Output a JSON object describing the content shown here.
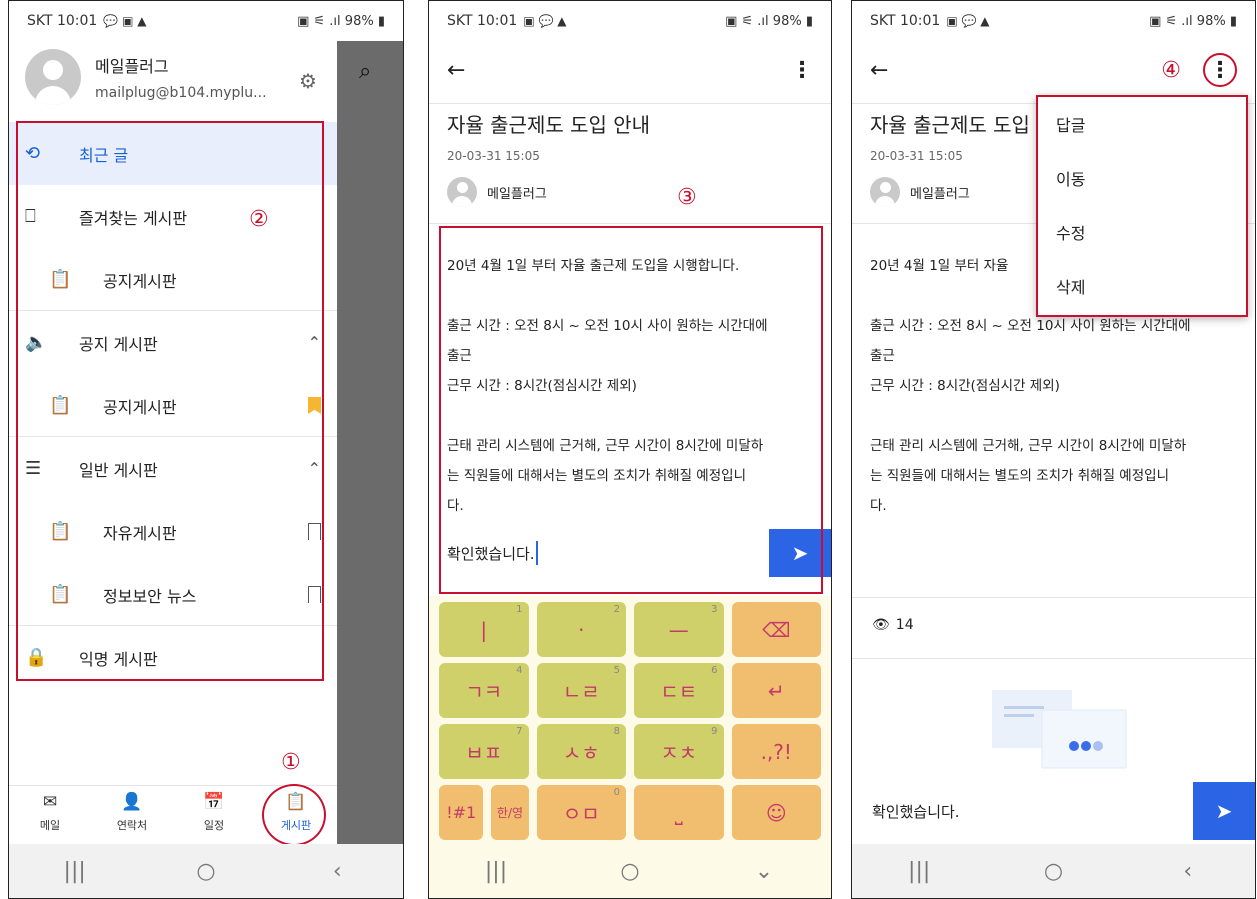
{
  "status": {
    "carrier_time": "SKT 10:01",
    "battery": "98%",
    "signal": "█ ≈ ≡ .▎"
  },
  "callouts": {
    "one": "①",
    "two": "②",
    "three": "③",
    "four": "④"
  },
  "drawer": {
    "profile": {
      "name": "메일플러그",
      "email": "mailplug@b104.myplu..."
    },
    "items": [
      {
        "label": "최근 글",
        "icon": "clock-history-icon"
      },
      {
        "label": "즐겨찾는 게시판",
        "icon": "bookmark-icon"
      },
      {
        "label": "공지게시판",
        "icon": "clipboard-icon"
      },
      {
        "label": "공지 게시판",
        "icon": "speaker-icon"
      },
      {
        "label": "공지게시판",
        "icon": "clipboard-icon"
      },
      {
        "label": "일반 게시판",
        "icon": "list-icon"
      },
      {
        "label": "자유게시판",
        "icon": "clipboard-icon"
      },
      {
        "label": "정보보안 뉴스",
        "icon": "clipboard-icon"
      },
      {
        "label": "익명 게시판",
        "icon": "lock-icon"
      }
    ],
    "tabs": [
      {
        "label": "메일",
        "icon": "mail-icon"
      },
      {
        "label": "연락처",
        "icon": "contacts-icon"
      },
      {
        "label": "일정",
        "icon": "calendar-icon"
      },
      {
        "label": "게시판",
        "icon": "board-icon"
      }
    ]
  },
  "post": {
    "title": "자율 출근제도 도입 안내",
    "title_cut": "자율 출근제도 도입",
    "date": "20-03-31 15:05",
    "author": "메일플러그",
    "lines": [
      "20년 4월 1일 부터 자율 출근제 도입을 시행합니다.",
      "",
      "출근 시간 : 오전 8시 ~ 오전 10시 사이 원하는 시간대에",
      "출근",
      "근무 시간 : 8시간(점심시간 제외)",
      "",
      "근태 관리 시스템에 근거해, 근무 시간이 8시간에 미달하",
      "는 직원들에 대해서는 별도의 조치가 취해질 예정입니",
      "다."
    ],
    "line1_cut": "20년 4월 1일 부터 자율",
    "views": "14",
    "reply_value": "확인했습니다.",
    "reply_sent": "확인했습니다."
  },
  "menu": {
    "items": [
      "답글",
      "이동",
      "수정",
      "삭제"
    ]
  },
  "keyboard": {
    "keys": [
      {
        "label": "|",
        "num": "1"
      },
      {
        "label": "·",
        "num": "2"
      },
      {
        "label": "—",
        "num": "3"
      },
      {
        "label": "⌫",
        "num": ""
      },
      {
        "label": "ㄱㅋ",
        "num": "4"
      },
      {
        "label": "ㄴㄹ",
        "num": "5"
      },
      {
        "label": "ㄷㅌ",
        "num": "6"
      },
      {
        "label": "↵",
        "num": ""
      },
      {
        "label": "ㅂㅍ",
        "num": "7"
      },
      {
        "label": "ㅅㅎ",
        "num": "8"
      },
      {
        "label": "ㅈㅊ",
        "num": "9"
      },
      {
        "label": ".,?!",
        "num": ""
      },
      {
        "label": "!#1",
        "num": ""
      },
      {
        "label": "한/영",
        "num": ""
      },
      {
        "label": "ㅇㅁ",
        "num": "0"
      },
      {
        "label": "⎵",
        "num": ""
      },
      {
        "label": "☺",
        "num": ""
      }
    ]
  },
  "colors": {
    "accent": "#2b65e6",
    "annotation": "#c8102e",
    "key_green": "#cfd06a",
    "key_orange": "#f0be6e"
  }
}
